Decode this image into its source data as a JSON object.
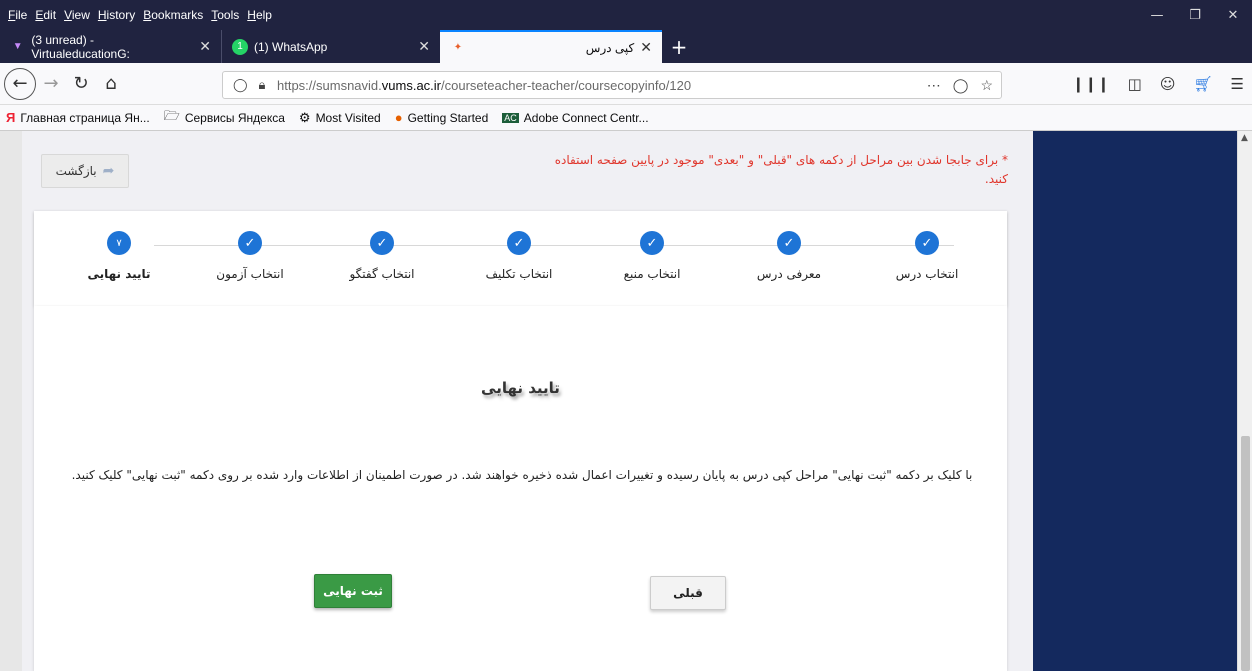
{
  "menu": [
    "File",
    "Edit",
    "View",
    "History",
    "Bookmarks",
    "Tools",
    "Help"
  ],
  "tabs": [
    {
      "label": "(3 unread) - VirtualeducationG:"
    },
    {
      "label": "(1) WhatsApp"
    },
    {
      "label": "کپی درس"
    }
  ],
  "url": {
    "prefix": "https://sumsnavid.",
    "domain": "vums.ac.ir",
    "path": "/courseteacher-teacher/coursecopyinfo/120"
  },
  "bookmarks": [
    {
      "label": "Главная страница Ян..."
    },
    {
      "label": "Сервисы Яндекса"
    },
    {
      "label": "Most Visited"
    },
    {
      "label": "Getting Started"
    },
    {
      "label": "Adobe Connect Centr..."
    }
  ],
  "page": {
    "back_label": "بازگشت",
    "note": "* برای جابجا شدن بین مراحل از دکمه های \"قبلی\" و \"بعدی\" موجود در پایین صفحه استفاده کنید.",
    "steps": [
      {
        "label": "انتخاب درس"
      },
      {
        "label": "معرفی درس"
      },
      {
        "label": "انتخاب منبع"
      },
      {
        "label": "انتخاب تکلیف"
      },
      {
        "label": "انتخاب گفتگو"
      },
      {
        "label": "انتخاب آزمون"
      },
      {
        "label": "تایید نهایی",
        "number": "۷"
      }
    ],
    "heading": "تایید نهایی",
    "description": "با کلیک بر دکمه \"ثبت نهایی\" مراحل کپی درس به پایان رسیده و تغییرات اعمال شده ذخیره خواهند شد. در صورت اطمینان از اطلاعات وارد شده بر روی دکمه \"ثبت نهایی\" کلیک کنید.",
    "final_button": "ثبت نهایی",
    "prev_button": "قبلی"
  },
  "colors": {
    "chrome": "#202340",
    "step_blue": "#1e74d6",
    "note_red": "#e0352b",
    "final_green": "#3a9a45",
    "side_panel": "#14295e"
  }
}
